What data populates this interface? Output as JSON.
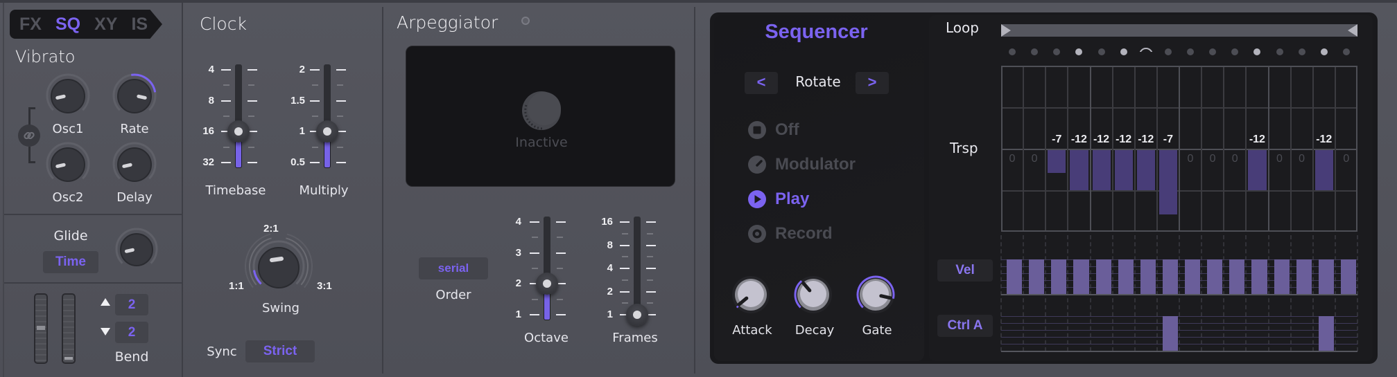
{
  "tabs": [
    {
      "label": "FX",
      "active": false
    },
    {
      "label": "SQ",
      "active": true
    },
    {
      "label": "XY",
      "active": false
    },
    {
      "label": "IS",
      "active": false
    }
  ],
  "vibrato": {
    "title": "Vibrato",
    "knobs": [
      {
        "label": "Osc1",
        "value": 0.12
      },
      {
        "label": "Rate",
        "value": 0.88
      },
      {
        "label": "Osc2",
        "value": 0.12
      },
      {
        "label": "Delay",
        "value": 0.12
      }
    ],
    "link_icon": "link-icon"
  },
  "glide": {
    "label": "Glide",
    "mode": "Time",
    "value": 0.12
  },
  "bend": {
    "label": "Bend",
    "up": "2",
    "down": "2",
    "wheel_pitch": 0.5,
    "wheel_mod": 0.0
  },
  "clock": {
    "title": "Clock",
    "timebase": {
      "label": "Timebase",
      "ticks": [
        "4",
        "8",
        "16",
        "32"
      ],
      "value": "16"
    },
    "multiply": {
      "label": "Multiply",
      "ticks": [
        "2",
        "1.5",
        "1",
        "0.5"
      ],
      "value": "1"
    },
    "swing": {
      "label": "Swing",
      "min_label": "1:1",
      "mid_label": "2:1",
      "max_label": "3:1",
      "value": 0.12
    },
    "sync": {
      "label": "Sync",
      "value": "Strict"
    }
  },
  "arpeggiator": {
    "title": "Arpeggiator",
    "status": "Inactive",
    "order": {
      "label": "Order",
      "value": "serial"
    },
    "octave": {
      "label": "Octave",
      "ticks": [
        "4",
        "3",
        "2",
        "1"
      ],
      "value": "2"
    },
    "frames": {
      "label": "Frames",
      "ticks": [
        "16",
        "8",
        "4",
        "2",
        "1"
      ],
      "value": "1"
    }
  },
  "sequencer": {
    "title": "Sequencer",
    "rotate": {
      "label": "Rotate",
      "prev": "<",
      "next": ">"
    },
    "modes": [
      {
        "label": "Off",
        "icon": "stop-icon",
        "active": false
      },
      {
        "label": "Modulator",
        "icon": "modulator-icon",
        "active": false
      },
      {
        "label": "Play",
        "icon": "play-icon",
        "active": true
      },
      {
        "label": "Record",
        "icon": "record-icon",
        "active": false
      }
    ],
    "envelope": [
      {
        "label": "Attack",
        "value": 0.02
      },
      {
        "label": "Decay",
        "value": 0.35
      },
      {
        "label": "Gate",
        "value": 0.88
      }
    ],
    "loop_label": "Loop",
    "trsp_label": "Trsp",
    "vel_label": "Vel",
    "ctrl_label": "Ctrl A",
    "steps_count": 16,
    "step_dots": [
      "off",
      "off",
      "off",
      "on",
      "off",
      "on",
      "tie",
      "off",
      "off",
      "off",
      "off",
      "on",
      "off",
      "off",
      "on",
      "off"
    ],
    "transpose_labels": [
      "0",
      "0",
      "-7",
      "-12",
      "-12",
      "-12",
      "-12",
      "-7",
      "0",
      "0",
      "0",
      "-12",
      "0",
      "0",
      "-12",
      "0"
    ],
    "transpose_depth": [
      0,
      0,
      -7,
      -12,
      -12,
      -12,
      -12,
      -19,
      0,
      0,
      0,
      -12,
      0,
      0,
      -12,
      0
    ],
    "velocity": [
      1,
      1,
      1,
      1,
      1,
      1,
      1,
      1,
      1,
      1,
      1,
      1,
      1,
      1,
      1,
      1
    ],
    "ctrl_a": [
      0,
      0,
      0,
      0,
      0,
      0,
      0,
      1,
      0,
      0,
      0,
      0,
      0,
      0,
      1,
      0
    ]
  },
  "colors": {
    "accent": "#7b63f0",
    "bar": "#483d78",
    "lane_bar": "#6a5e9a"
  }
}
